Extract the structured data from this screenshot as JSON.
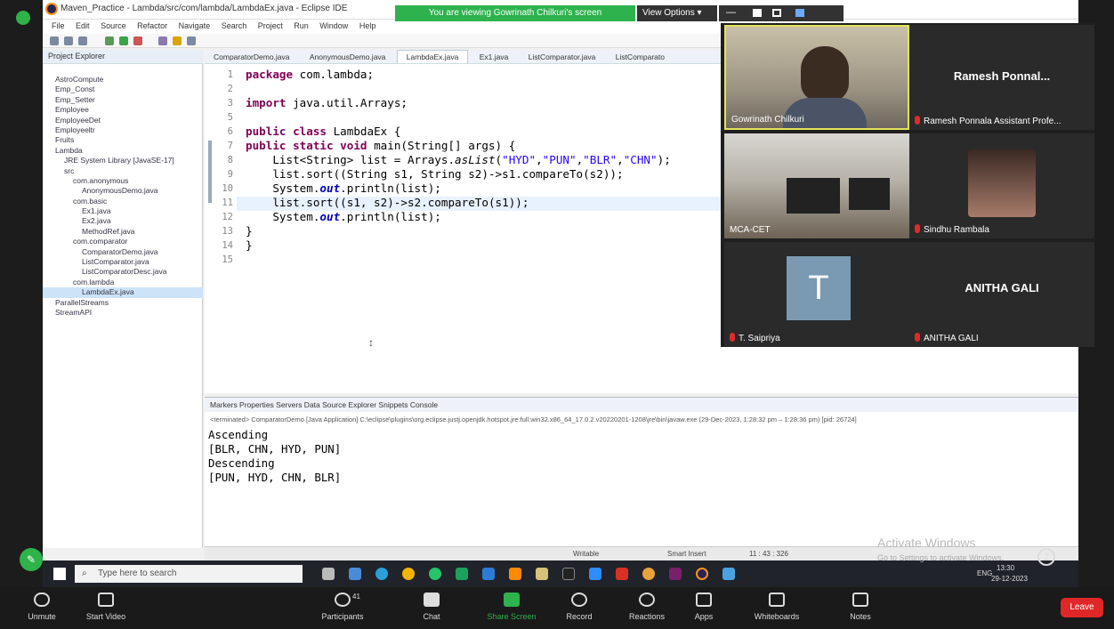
{
  "eclipse": {
    "title": "Maven_Practice - Lambda/src/com/lambda/LambdaEx.java - Eclipse IDE",
    "menu": [
      "File",
      "Edit",
      "Source",
      "Refactor",
      "Navigate",
      "Search",
      "Project",
      "Run",
      "Window",
      "Help"
    ],
    "project_explorer": {
      "title": "Project Explorer",
      "tree": [
        {
          "label": "AstroCompute",
          "indent": 1
        },
        {
          "label": "Emp_Const",
          "indent": 1
        },
        {
          "label": "Emp_Setter",
          "indent": 1
        },
        {
          "label": "Employee",
          "indent": 1
        },
        {
          "label": "EmployeeDet",
          "indent": 1
        },
        {
          "label": "Employeeltr",
          "indent": 1
        },
        {
          "label": "Fruits",
          "indent": 1
        },
        {
          "label": "Lambda",
          "indent": 1
        },
        {
          "label": "JRE System Library [JavaSE-17]",
          "indent": 2
        },
        {
          "label": "src",
          "indent": 2
        },
        {
          "label": "com.anonymous",
          "indent": 3
        },
        {
          "label": "AnonymousDemo.java",
          "indent": 4
        },
        {
          "label": "com.basic",
          "indent": 3
        },
        {
          "label": "Ex1.java",
          "indent": 4
        },
        {
          "label": "Ex2.java",
          "indent": 4
        },
        {
          "label": "MethodRef.java",
          "indent": 4
        },
        {
          "label": "com.comparator",
          "indent": 3
        },
        {
          "label": "ComparatorDemo.java",
          "indent": 4
        },
        {
          "label": "ListComparator.java",
          "indent": 4
        },
        {
          "label": "ListComparatorDesc.java",
          "indent": 4
        },
        {
          "label": "com.lambda",
          "indent": 3
        },
        {
          "label": "LambdaEx.java",
          "indent": 4,
          "selected": true
        },
        {
          "label": "ParallelStreams",
          "indent": 1
        },
        {
          "label": "StreamAPI",
          "indent": 1
        }
      ]
    },
    "editor_tabs": [
      "ComparatorDemo.java",
      "AnonymousDemo.java",
      "LambdaEx.java",
      "Ex1.java",
      "ListComparator.java",
      "ListComparato"
    ],
    "active_tab": "LambdaEx.java",
    "line_numbers": [
      "1",
      "2",
      "3",
      "5",
      "6",
      "7",
      "8",
      "9",
      "10",
      "11",
      "12",
      "13",
      "14",
      "15"
    ],
    "code": {
      "l1_kw": "package",
      "l1_rest": " com.lambda;",
      "l3_kw": "import",
      "l3_rest": " java.util.Arrays;",
      "l6_kw": "public class",
      "l6_rest": " LambdaEx {",
      "l7_kw": "public static void",
      "l7_rest": " main(String[] args) {",
      "l8_a": "    List<String> list = Arrays.",
      "l8_m": "asList",
      "l8_b": "(",
      "l8_s1": "\"HYD\"",
      "l8_s2": "\"PUN\"",
      "l8_s3": "\"BLR\"",
      "l8_s4": "\"CHN\"",
      "l8_c": ");",
      "l9": "    list.sort((String s1, String s2)->s1.compareTo(s2));",
      "l10_a": "    System.",
      "l10_f": "out",
      "l10_b": ".println(list);",
      "l11": "    list.sort((s1, s2)->s2.compareTo(s1));",
      "l12_a": "    System.",
      "l12_f": "out",
      "l12_b": ".println(list);",
      "l13": "}",
      "l14": "}"
    },
    "console": {
      "tabs": "Markers  Properties  Servers  Data Source Explorer  Snippets  Console",
      "path": "<terminated> ComparatorDemo [Java Application] C:\\eclipse\\plugins\\org.eclipse.justj.openjdk.hotspot.jre.full.win32.x86_64_17.0.2.v20220201-1208\\jre\\bin\\javaw.exe  (29-Dec-2023, 1:28:32 pm – 1:28:36 pm) [pid: 26724]",
      "output": [
        "Ascending",
        "[BLR, CHN, HYD, PUN]",
        "Descending",
        "[PUN, HYD, CHN, BLR]"
      ]
    },
    "status": {
      "writable": "Writable",
      "insert": "Smart Insert",
      "position": "11 : 43 : 326"
    }
  },
  "zoom": {
    "share_banner": "You are viewing Gowrinath Chilkuri's screen",
    "view_options": "View Options",
    "participants": [
      {
        "name": "Gowrinath Chilkuri",
        "kind": "video"
      },
      {
        "name": "Ramesh Ponnala Assistant Profe...",
        "big": "Ramesh  Ponnal...",
        "muted": true
      },
      {
        "name": "MCA-CET",
        "kind": "video"
      },
      {
        "name": "Sindhu Rambala",
        "kind": "photo",
        "muted": true
      },
      {
        "name": "T. Saipriya",
        "initial": "T",
        "muted": true
      },
      {
        "name": "ANITHA GALI",
        "big": "ANITHA GALI",
        "muted": true
      }
    ],
    "toolbar": [
      {
        "label": "Unmute",
        "icon": "mic-muted-icon"
      },
      {
        "label": "Start Video",
        "icon": "video-off-icon"
      },
      {
        "label": "Participants",
        "icon": "participants-icon",
        "count": "41"
      },
      {
        "label": "Chat",
        "icon": "chat-icon"
      },
      {
        "label": "Share Screen",
        "icon": "share-screen-icon"
      },
      {
        "label": "Record",
        "icon": "record-icon"
      },
      {
        "label": "Reactions",
        "icon": "reactions-icon"
      },
      {
        "label": "Apps",
        "icon": "apps-icon"
      },
      {
        "label": "Whiteboards",
        "icon": "whiteboard-icon"
      },
      {
        "label": "Notes",
        "icon": "notes-icon"
      }
    ],
    "leave": "Leave",
    "colors": {
      "share_green": "#2eb24e",
      "leave_red": "#e02727",
      "muted_red": "#e02a2a"
    }
  },
  "windows": {
    "search_placeholder": "Type here to search",
    "activate_title": "Activate Windows",
    "activate_sub": "Go to Settings to activate Windows.",
    "lang": "ENG",
    "time": "13:30",
    "date": "29-12-2023",
    "notif_count": "2"
  }
}
